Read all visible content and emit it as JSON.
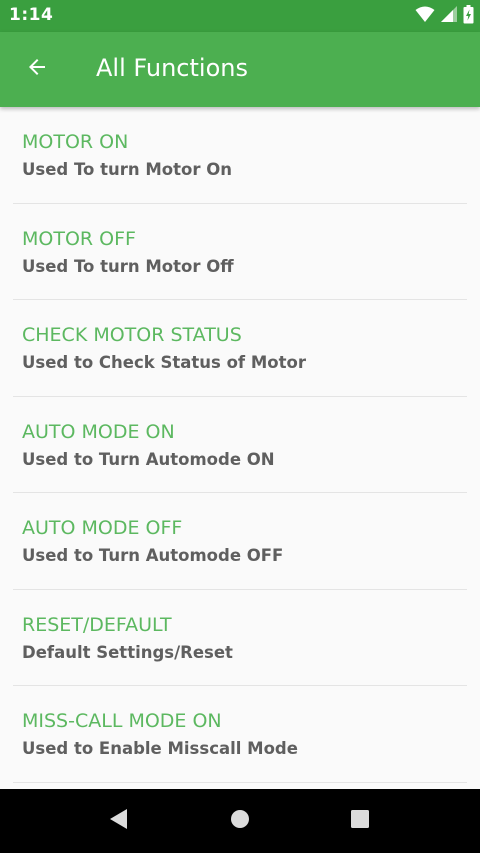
{
  "status_bar": {
    "time": "1:14",
    "icons": [
      "wifi-icon",
      "cell-signal-icon",
      "battery-charging-icon"
    ]
  },
  "app_bar": {
    "title": "All Functions",
    "back_icon": "arrow-back-icon",
    "color": "#4caf50"
  },
  "functions": [
    {
      "title": "MOTOR ON",
      "subtitle": "Used To turn Motor On"
    },
    {
      "title": "MOTOR OFF",
      "subtitle": "Used To turn Motor Off"
    },
    {
      "title": "CHECK MOTOR STATUS",
      "subtitle": "Used to Check Status of Motor"
    },
    {
      "title": "AUTO MODE ON",
      "subtitle": "Used to Turn Automode ON"
    },
    {
      "title": "AUTO MODE OFF",
      "subtitle": "Used to Turn Automode OFF"
    },
    {
      "title": "RESET/DEFAULT",
      "subtitle": "Default Settings/Reset"
    },
    {
      "title": "MISS-CALL MODE ON",
      "subtitle": "Used to Enable Misscall Mode"
    }
  ],
  "colors": {
    "status_bar": "#3a9f3f",
    "accent": "#4caf50",
    "item_title": "#5cb860",
    "item_subtitle": "#5f5f5f"
  },
  "nav_bar": {
    "icons": [
      "nav-back-icon",
      "nav-home-icon",
      "nav-recents-icon"
    ]
  }
}
